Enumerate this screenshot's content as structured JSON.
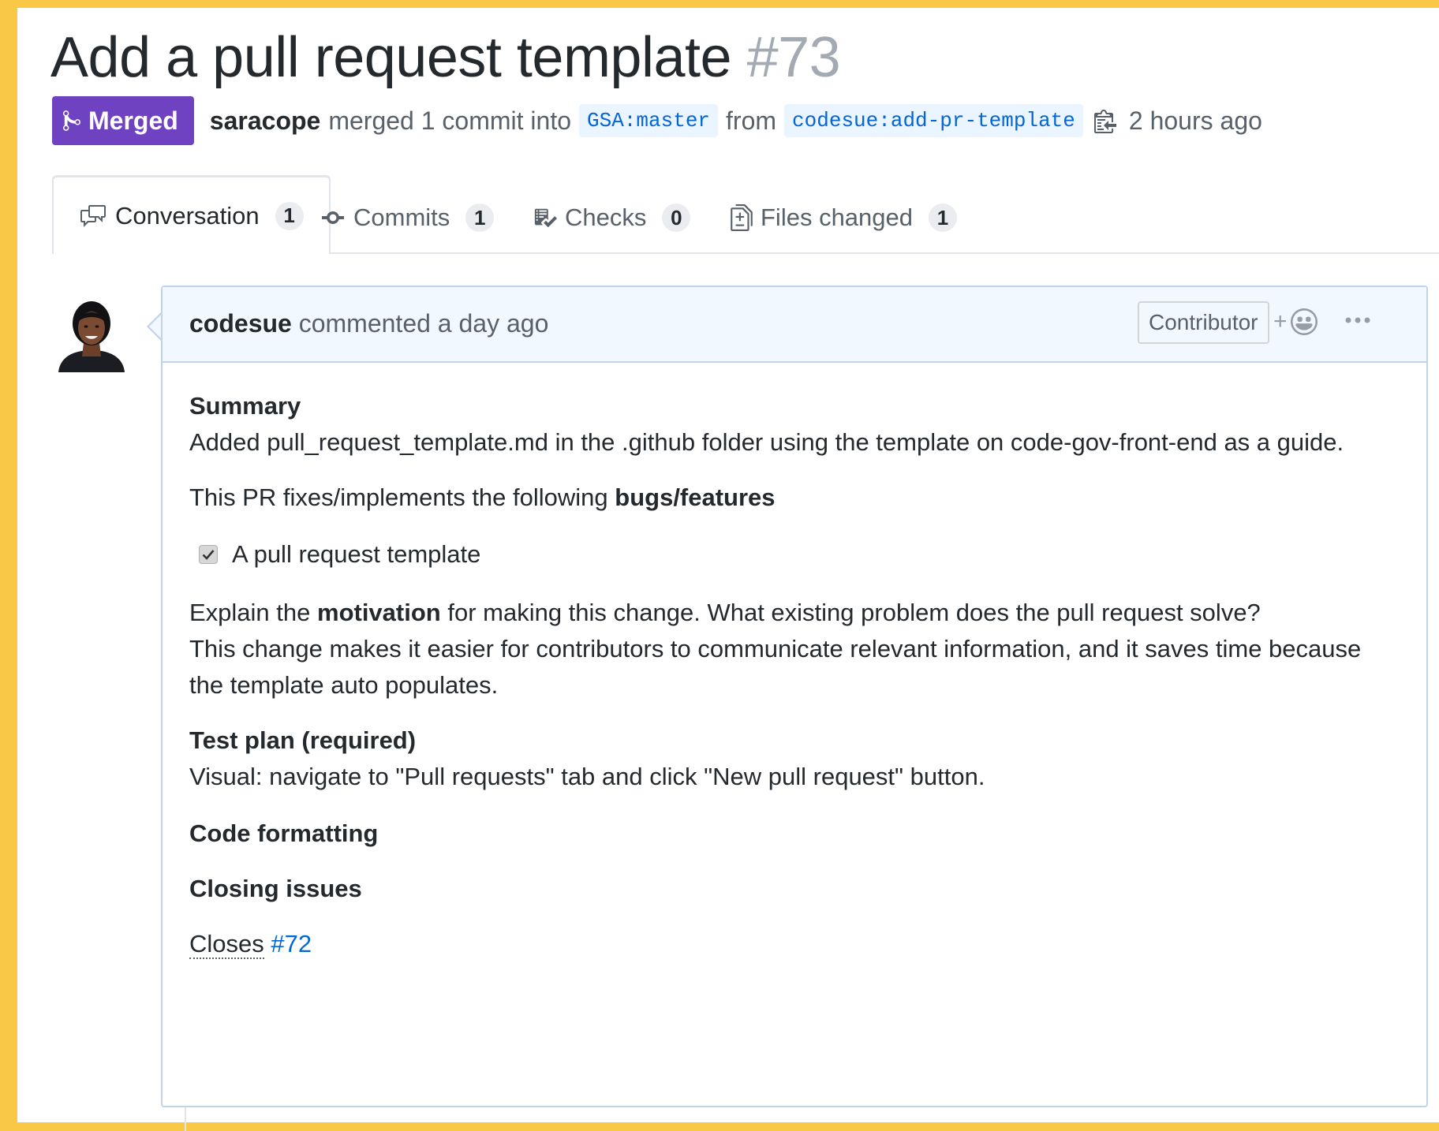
{
  "header": {
    "title": "Add a pull request template",
    "number": "#73"
  },
  "meta": {
    "state_label": "Merged",
    "author": "saracope",
    "action_text": "merged 1 commit into",
    "base_branch": "GSA:master",
    "from_text": "from",
    "head_branch": "codesue:add-pr-template",
    "time_ago": "2 hours ago"
  },
  "tabs": [
    {
      "label": "Conversation",
      "count": "1",
      "icon": "comment-discussion-icon",
      "selected": true
    },
    {
      "label": "Commits",
      "count": "1",
      "icon": "git-commit-icon"
    },
    {
      "label": "Checks",
      "count": "0",
      "icon": "checklist-icon"
    },
    {
      "label": "Files changed",
      "count": "1",
      "icon": "diff-icon"
    }
  ],
  "comment": {
    "author": "codesue",
    "action": "commented a day ago",
    "role": "Contributor",
    "reaction_plus": "+",
    "body": {
      "summary_heading": "Summary",
      "summary_text": "Added pull_request_template.md in the .github folder using the template on code-gov-front-end as a guide.",
      "fixes_prefix": "This PR fixes/implements the following ",
      "fixes_bold": "bugs/features",
      "checklist_item": "A pull request template",
      "checklist_checked": true,
      "motivation_prefix": "Explain the ",
      "motivation_bold": "motivation",
      "motivation_suffix": " for making this change. What existing problem does the pull request solve?",
      "motivation_text": "This change makes it easier for contributors to communicate relevant information, and it saves time because the template auto populates.",
      "test_plan_heading": "Test plan (required)",
      "test_plan_text": "Visual: navigate to \"Pull requests\" tab and click \"New pull request\" button.",
      "code_formatting_heading": "Code formatting",
      "closing_issues_heading": "Closing issues",
      "closes_word": "Closes",
      "closes_issue": "#72"
    }
  },
  "colors": {
    "merged": "#6f42c1",
    "link": "#0366d6",
    "comment_header_bg": "#f1f8ff",
    "frame": "#f9c846"
  }
}
